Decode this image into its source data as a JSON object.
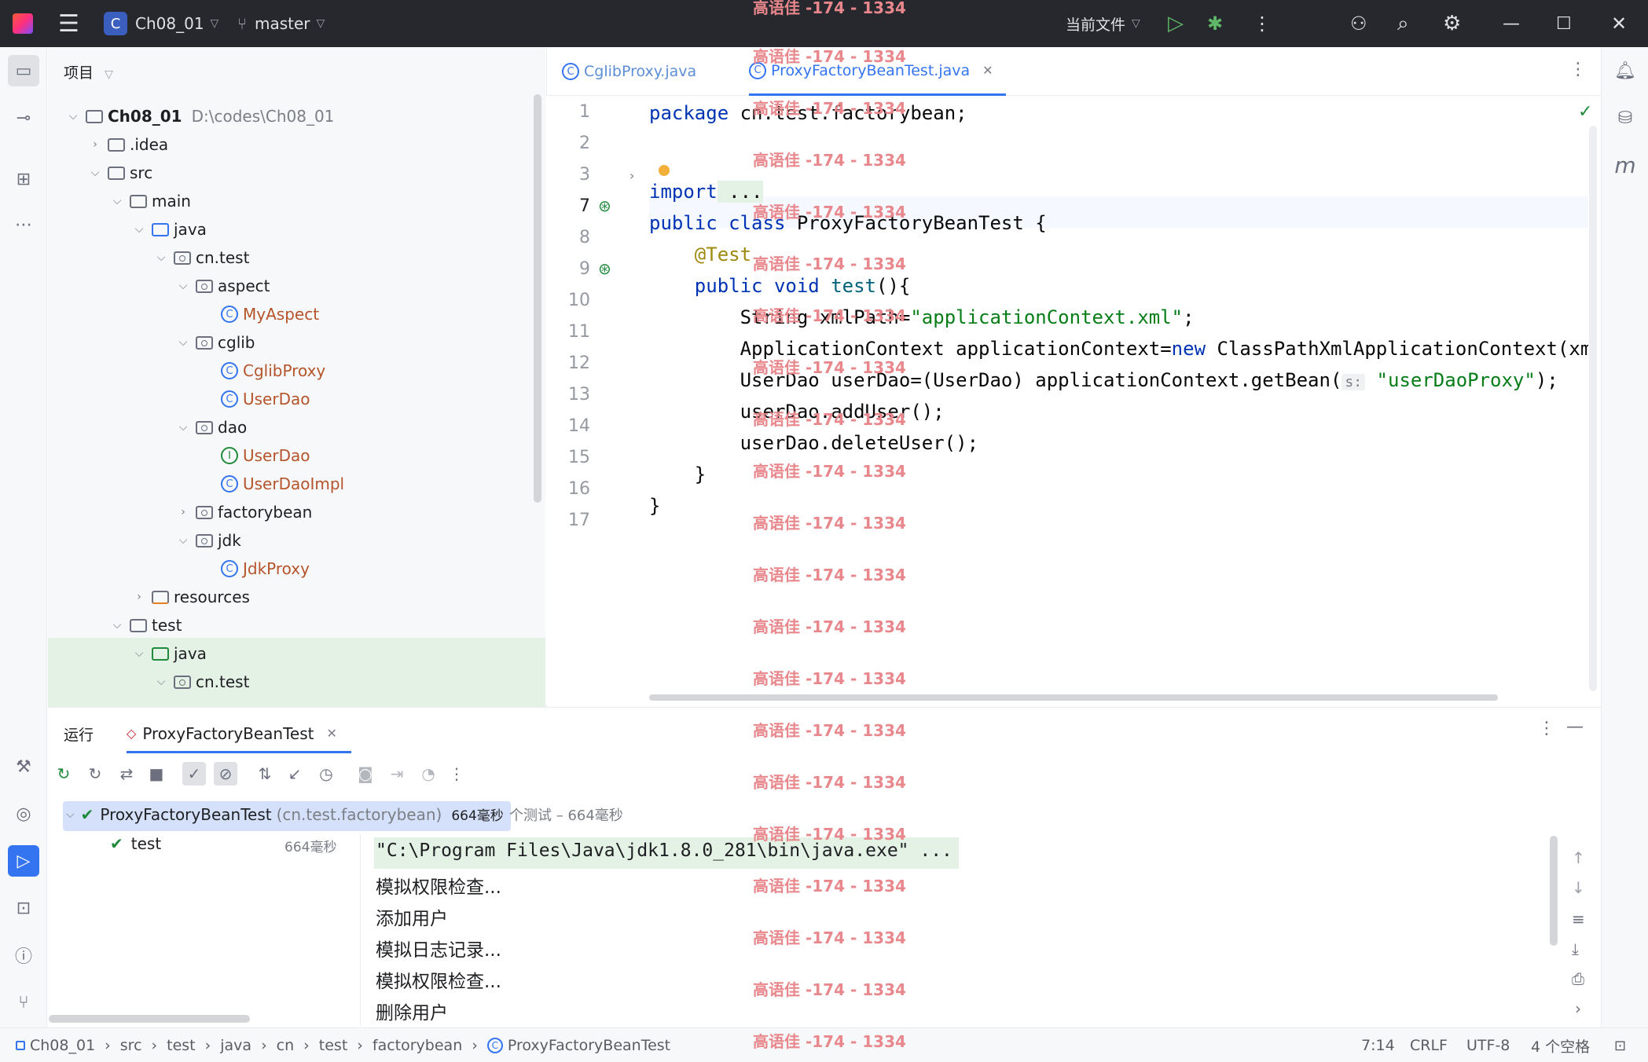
{
  "titlebar": {
    "project_badge": "C",
    "project_name": "Ch08_01",
    "branch": "master",
    "run_config": "当前文件"
  },
  "project_panel": {
    "header": "项目",
    "root_name": "Ch08_01",
    "root_path": "D:\\codes\\Ch08_01",
    "items": [
      {
        "label": ".idea"
      },
      {
        "label": "src"
      },
      {
        "label": "main"
      },
      {
        "label": "java"
      },
      {
        "label": "cn.test"
      },
      {
        "label": "aspect"
      },
      {
        "label": "MyAspect"
      },
      {
        "label": "cglib"
      },
      {
        "label": "CglibProxy"
      },
      {
        "label": "UserDao"
      },
      {
        "label": "dao"
      },
      {
        "label": "UserDao"
      },
      {
        "label": "UserDaoImpl"
      },
      {
        "label": "factorybean"
      },
      {
        "label": "jdk"
      },
      {
        "label": "JdkProxy"
      },
      {
        "label": "resources"
      },
      {
        "label": "test"
      },
      {
        "label": "java"
      },
      {
        "label": "cn.test"
      }
    ]
  },
  "editor": {
    "tabs": [
      {
        "label": "CglibProxy.java"
      },
      {
        "label": "ProxyFactoryBeanTest.java"
      }
    ],
    "line_numbers": [
      "1",
      "2",
      "3",
      "7",
      "8",
      "9",
      "10",
      "11",
      "12",
      "13",
      "14",
      "15",
      "16",
      "17"
    ],
    "code": {
      "l1_kw": "package",
      "l1_rest": " cn.test.factorybean;",
      "l3_kw": "import",
      "l3_rest": " ...",
      "l7_kw": "public class",
      "l7_rest": " ProxyFactoryBeanTest {",
      "l8": "    @Test",
      "l9_kw": "    public void",
      "l9_fn": " test",
      "l9_rest": "(){",
      "l10_a": "        String xmlPath=",
      "l10_str": "\"applicationContext.xml\"",
      "l10_b": ";",
      "l11_a": "        ApplicationContext applicationContext=",
      "l11_kw": "new",
      "l11_b": " ClassPathXmlApplicationContext(xmlPat",
      "l12_a": "        UserDao userDao=(UserDao) applicationContext.getBean(",
      "l12_hint": "s:",
      "l12_str": " \"userDaoProxy\"",
      "l12_b": ");",
      "l13": "        userDao.addUser();",
      "l14": "        userDao.deleteUser();",
      "l15": "    }",
      "l16": "}"
    }
  },
  "run_panel": {
    "title": "运行",
    "tab_label": "ProxyFactoryBeanTest",
    "test_root": "ProxyFactoryBeanTest",
    "test_root_pkg": "(cn.test.factorybean)",
    "test_root_time": "664毫秒",
    "test_child": "test",
    "test_child_time": "664毫秒",
    "summary": "个测试 – 664毫秒",
    "console": [
      "\"C:\\Program Files\\Java\\jdk1.8.0_281\\bin\\java.exe\" ...",
      "模拟权限检查...",
      "添加用户",
      "模拟日志记录...",
      "模拟权限检查...",
      "删除用户"
    ]
  },
  "statusbar": {
    "breadcrumbs": [
      "Ch08_01",
      "src",
      "test",
      "java",
      "cn",
      "test",
      "factorybean",
      "ProxyFactoryBeanTest"
    ],
    "position": "7:14",
    "line_sep": "CRLF",
    "encoding": "UTF-8",
    "indent": "4 个空格"
  },
  "watermark": "高语佳 -174 - 1334"
}
